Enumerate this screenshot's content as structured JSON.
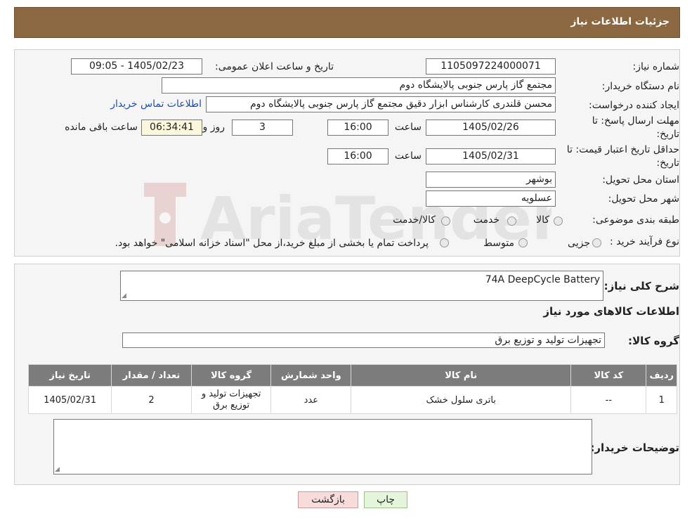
{
  "header": {
    "title": "جزئیات اطلاعات نیاز"
  },
  "form": {
    "need_number_label": "شماره نیاز:",
    "need_number_value": "1105097224000071",
    "announce_label": "تاریخ و ساعت اعلان عمومی:",
    "announce_value": "1405/02/23 - 09:05",
    "buyer_label": "نام دستگاه خریدار:",
    "buyer_value": "مجتمع گاز پارس جنوبی  پالایشگاه دوم",
    "creator_label": "ایجاد کننده درخواست:",
    "creator_value": "محسن قلندری کارشناس ابزار دقیق مجتمع گاز پارس جنوبی  پالایشگاه دوم",
    "contact_link": "اطلاعات تماس خریدار",
    "deadline_label_1": "مهلت ارسال پاسخ: تا",
    "deadline_label_2": "تاریخ:",
    "deadline_date": "1405/02/26",
    "time_label": "ساعت",
    "deadline_time": "16:00",
    "days_value": "3",
    "days_label": "روز و",
    "remaining_time": "06:34:41",
    "remaining_label": "ساعت باقی مانده",
    "validity_label_1": "حداقل تاریخ اعتبار قیمت: تا",
    "validity_label_2": "تاریخ:",
    "validity_date": "1405/02/31",
    "validity_time_label": "ساعت",
    "validity_time": "16:00",
    "province_label": "استان محل تحویل:",
    "province_value": "بوشهر",
    "city_label": "شهر محل تحویل:",
    "city_value": "عسلویه",
    "category_label": "طبقه بندی موضوعی:",
    "category_options": [
      "کالا",
      "خدمت",
      "کالا/خدمت"
    ],
    "process_label": "نوع فرآیند خرید :",
    "process_options": [
      "جزیی",
      "متوسط"
    ],
    "process_note": "پرداخت تمام یا بخشی از مبلغ خرید،از محل \"اسناد خزانه اسلامی\" خواهد بود."
  },
  "details": {
    "summary_label": "شرح کلی نیاز:",
    "summary_value": "74A DeepCycle Battery",
    "goods_info_title": "اطلاعات کالاهای مورد نیاز",
    "group_label": "گروه کالا:",
    "group_value": "تجهیزات تولید و توزیع برق",
    "table": {
      "headers": [
        "ردیف",
        "کد کالا",
        "نام کالا",
        "واحد شمارش",
        "گروه کالا",
        "تعداد / مقدار",
        "تاریخ نیاز"
      ],
      "rows": [
        [
          "1",
          "--",
          "باتری سلول خشک",
          "عدد",
          "تجهیزات تولید و توزیع برق",
          "2",
          "1405/02/31"
        ]
      ]
    },
    "buyer_notes_label": "توضیحات خریدار:",
    "buyer_notes_value": ""
  },
  "buttons": {
    "print": "چاپ",
    "back": "بازگشت"
  },
  "watermark": {
    "text": "AriaTender.neT"
  },
  "colors": {
    "header": "#8b6841",
    "table_header": "#7c7c7c",
    "link": "#1a4fb5",
    "back_button": "#f8dcdc",
    "print_button": "#e5f5dc"
  }
}
